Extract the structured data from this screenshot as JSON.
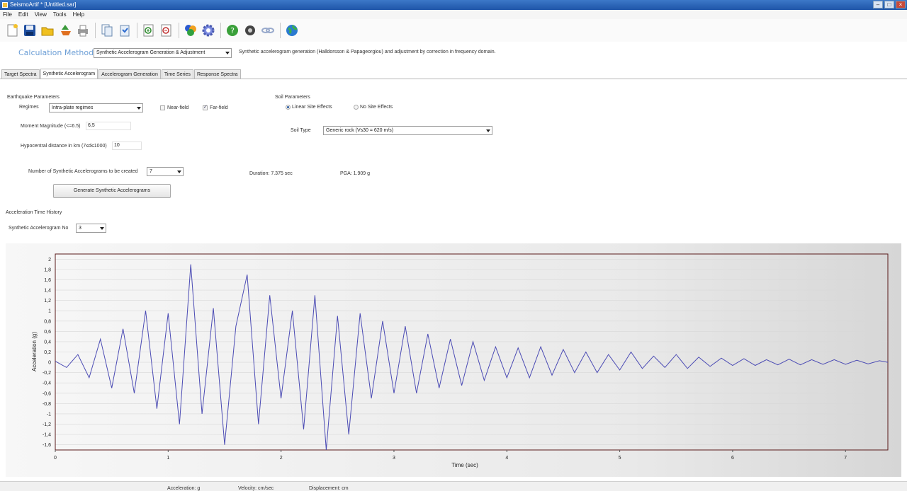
{
  "window": {
    "title": "SeismoArtif * [Untitled.sar]"
  },
  "menu": [
    "File",
    "Edit",
    "View",
    "Tools",
    "Help"
  ],
  "toolbar": {
    "icons": [
      "new-file-icon",
      "save-icon",
      "open-folder-icon",
      "recycle-icon",
      "print-icon",
      "copy-icon",
      "paste-icon",
      "zoom-in-icon",
      "zoom-out-icon",
      "colors-icon",
      "settings-gear-icon",
      "help-icon",
      "tools-icon",
      "link-icon",
      "web-globe-icon"
    ]
  },
  "calc": {
    "label": "Calculation Method",
    "method": "Synthetic Accelerogram Generation & Adjustment",
    "description": "Synthetic accelerogram generation (Halldorsson & Papageorgiou) and adjustment by correction in frequency domain."
  },
  "tabs": [
    "Target Spectra",
    "Synthetic Accelerogram",
    "Accelerogram Generation",
    "Time Series",
    "Response Spectra"
  ],
  "eq": {
    "title": "Earthquake Parameters",
    "regimes_label": "Regimes",
    "regimes_value": "Intra-plate regimes",
    "near_field": "Near-field",
    "far_field": "Far-field",
    "magnitude_label": "Moment Magnitude (<=6.5)",
    "magnitude_value": "6,5",
    "distance_label": "Hypocentral distance in km (7≤d≤1000)",
    "distance_value": "10"
  },
  "soil": {
    "title": "Soil Parameters",
    "linear": "Linear Site Effects",
    "none": "No Site Effects",
    "type_label": "Soil Type",
    "type_value": "Generic rock (Vs30 = 620 m/s)"
  },
  "gen": {
    "count_label": "Number of Synthetic Accelerograms to be created",
    "count_value": "7",
    "duration": "Duration: 7.375 sec",
    "pga": "PGA: 1.909 g",
    "button": "Generate Synthetic Accelerograms"
  },
  "history": {
    "title": "Acceleration Time History",
    "select_label": "Synthetic Accelerogram No",
    "select_value": "3"
  },
  "status": {
    "acceleration": "Acceleration: g",
    "velocity": "Velocity: cm/sec",
    "displacement": "Displacement: cm"
  },
  "colors": {
    "series": "#4b4bb4",
    "plot_border": "#5a1a1a"
  },
  "chart_data": {
    "type": "line",
    "xlabel": "Time (sec)",
    "ylabel": "Acceleration (g)",
    "xlim": [
      0,
      7.375
    ],
    "ylim": [
      -1.7,
      2.1
    ],
    "xticks": [
      0,
      1,
      2,
      3,
      4,
      5,
      6,
      7
    ],
    "yticks": [
      "2",
      "1,8",
      "1,6",
      "1,4",
      "1,2",
      "1",
      "0,8",
      "0,6",
      "0,4",
      "0,2",
      "0",
      "-0,2",
      "-0,4",
      "-0,6",
      "-0,8",
      "-1",
      "-1,2",
      "-1,4",
      "-1,6"
    ],
    "grid": true,
    "series": [
      {
        "x": [
          0,
          0.1,
          0.2,
          0.3,
          0.4,
          0.5,
          0.6,
          0.7,
          0.8,
          0.9,
          1.0,
          1.1,
          1.2,
          1.3,
          1.4,
          1.5,
          1.6,
          1.7,
          1.8,
          1.9,
          2.0,
          2.1,
          2.2,
          2.3,
          2.4,
          2.5,
          2.6,
          2.7,
          2.8,
          2.9,
          3.0,
          3.1,
          3.2,
          3.3,
          3.4,
          3.5,
          3.6,
          3.7,
          3.8,
          3.9,
          4.0,
          4.1,
          4.2,
          4.3,
          4.4,
          4.5,
          4.6,
          4.7,
          4.8,
          4.9,
          5.0,
          5.1,
          5.2,
          5.3,
          5.4,
          5.5,
          5.6,
          5.7,
          5.8,
          5.9,
          6.0,
          6.1,
          6.2,
          6.3,
          6.4,
          6.5,
          6.6,
          6.7,
          6.8,
          6.9,
          7.0,
          7.1,
          7.2,
          7.3,
          7.375
        ],
        "values": [
          0.02,
          -0.1,
          0.15,
          -0.3,
          0.45,
          -0.5,
          0.65,
          -0.6,
          1.0,
          -0.9,
          0.95,
          -1.2,
          1.9,
          -1.0,
          1.05,
          -1.6,
          0.7,
          1.7,
          -1.2,
          1.3,
          -0.7,
          1.0,
          -1.3,
          1.3,
          -1.7,
          0.9,
          -1.4,
          0.95,
          -0.7,
          0.8,
          -0.6,
          0.7,
          -0.6,
          0.55,
          -0.5,
          0.45,
          -0.45,
          0.4,
          -0.35,
          0.3,
          -0.3,
          0.28,
          -0.3,
          0.3,
          -0.25,
          0.25,
          -0.2,
          0.2,
          -0.2,
          0.15,
          -0.15,
          0.2,
          -0.12,
          0.12,
          -0.1,
          0.15,
          -0.12,
          0.1,
          -0.08,
          0.08,
          -0.06,
          0.07,
          -0.06,
          0.05,
          -0.05,
          0.06,
          -0.05,
          0.05,
          -0.04,
          0.05,
          -0.04,
          0.04,
          -0.03,
          0.03,
          0.0
        ]
      }
    ]
  }
}
